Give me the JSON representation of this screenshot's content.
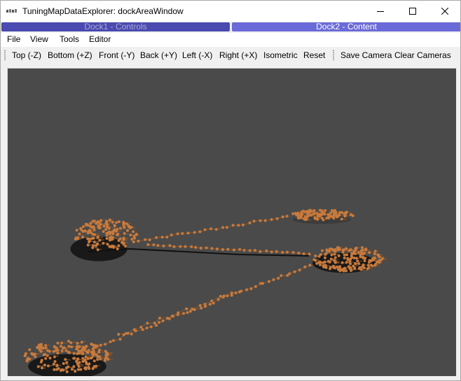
{
  "window": {
    "title": "TuningMapDataExplorer: dockAreaWindow",
    "app_icon": "vtk-logo-icon",
    "controls": [
      "minimize-icon",
      "maximize-icon",
      "close-icon"
    ]
  },
  "docks": {
    "tabs": [
      {
        "label": "Dock1 - Controls",
        "active": false
      },
      {
        "label": "Dock2 - Content",
        "active": true
      }
    ]
  },
  "menubar": {
    "items": [
      "File",
      "View",
      "Tools",
      "Editor"
    ]
  },
  "toolbar": {
    "view_buttons": [
      "Top (-Z)",
      "Bottom (+Z)",
      "Front (-Y)",
      "Back (+Y)",
      "Left (-X)",
      "Right (+X)",
      "Isometric",
      "Reset"
    ],
    "camera_buttons": [
      "Save Camera",
      "Clear Cameras"
    ]
  },
  "viewport": {
    "background": "#4a4a4a",
    "point_color": "#c87a3c",
    "shadow_color": "#111111"
  }
}
